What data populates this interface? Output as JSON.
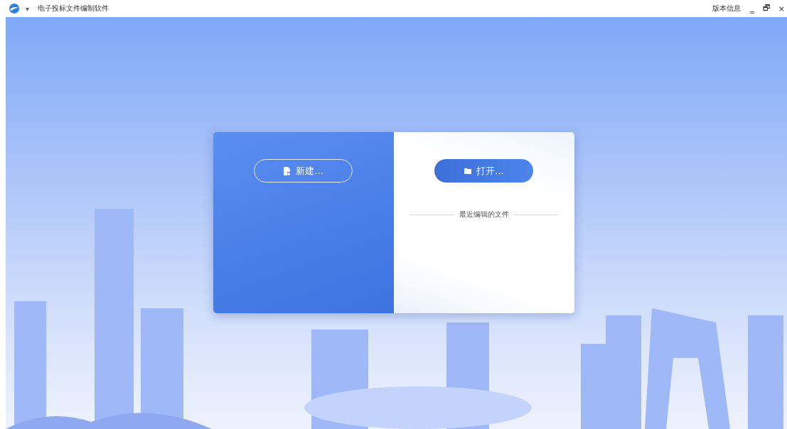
{
  "window": {
    "title": "电子投标文件编制软件",
    "menu_caret": "▾",
    "version_info": "版本信息",
    "controls": [
      "‗",
      "🗗",
      "×"
    ]
  },
  "start_card": {
    "new_button": "新建...",
    "open_button": "打开...",
    "recent_heading": "最近编辑的文件"
  }
}
